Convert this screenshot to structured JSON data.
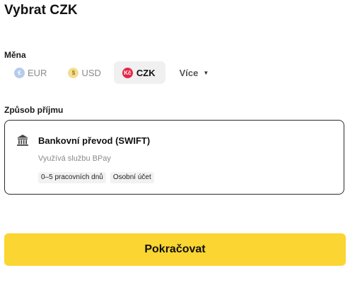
{
  "page": {
    "title": "Vybrat CZK"
  },
  "currency": {
    "label": "Měna",
    "options": [
      {
        "code": "EUR",
        "symbol": "€",
        "color": "#b5ccec"
      },
      {
        "code": "USD",
        "symbol": "$",
        "color": "#f4dd92"
      },
      {
        "code": "CZK",
        "symbol": "Kč",
        "color": "#e5274a"
      }
    ],
    "selected": "CZK",
    "more_label": "Více"
  },
  "payout": {
    "label": "Způsob příjmu",
    "method": {
      "icon": "bank-icon",
      "name": "Bankovní převod (SWIFT)",
      "subtitle": "Využívá službu BPay",
      "tags": [
        "0–5 pracovních dnů",
        "Osobní účet"
      ]
    }
  },
  "actions": {
    "continue_label": "Pokračovat",
    "continue_color": "#fbd531"
  }
}
